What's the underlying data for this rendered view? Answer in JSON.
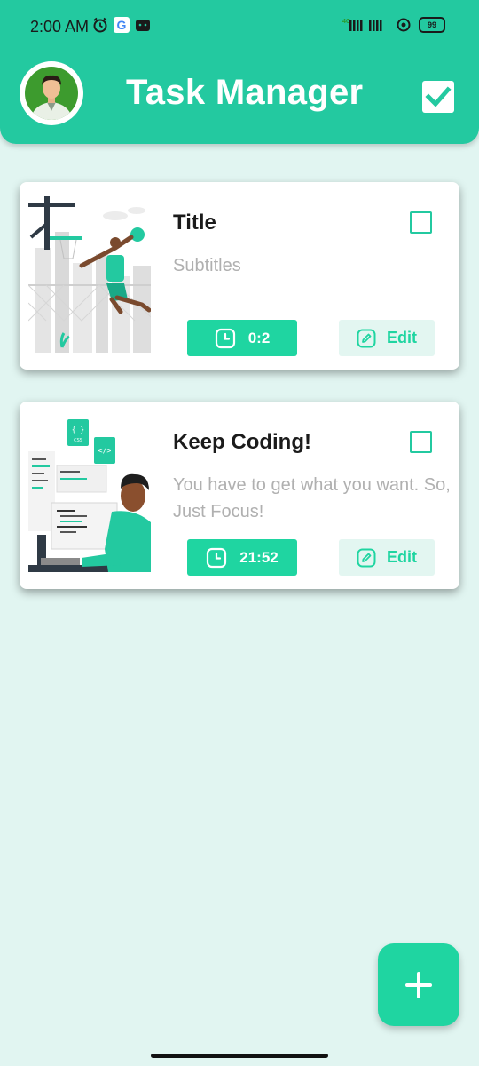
{
  "status_bar": {
    "time": "2:00 AM",
    "network_label": "4G",
    "battery": "99"
  },
  "header": {
    "title": "Task Manager"
  },
  "tasks": [
    {
      "title": "Title",
      "subtitle": "Subtitles",
      "timer": "0:2",
      "edit_label": "Edit",
      "illustration": "basketball-player-illustration"
    },
    {
      "title": "Keep Coding!",
      "subtitle": "You have to get what you want. So, Just Focus!",
      "timer": "21:52",
      "edit_label": "Edit",
      "illustration": "coding-developer-illustration"
    }
  ],
  "fab": {
    "icon": "plus-icon"
  },
  "colors": {
    "primary": "#23c9a0",
    "accent": "#1fd5a1",
    "background": "#e1f5f1",
    "subtitle": "#b0b0b0"
  }
}
